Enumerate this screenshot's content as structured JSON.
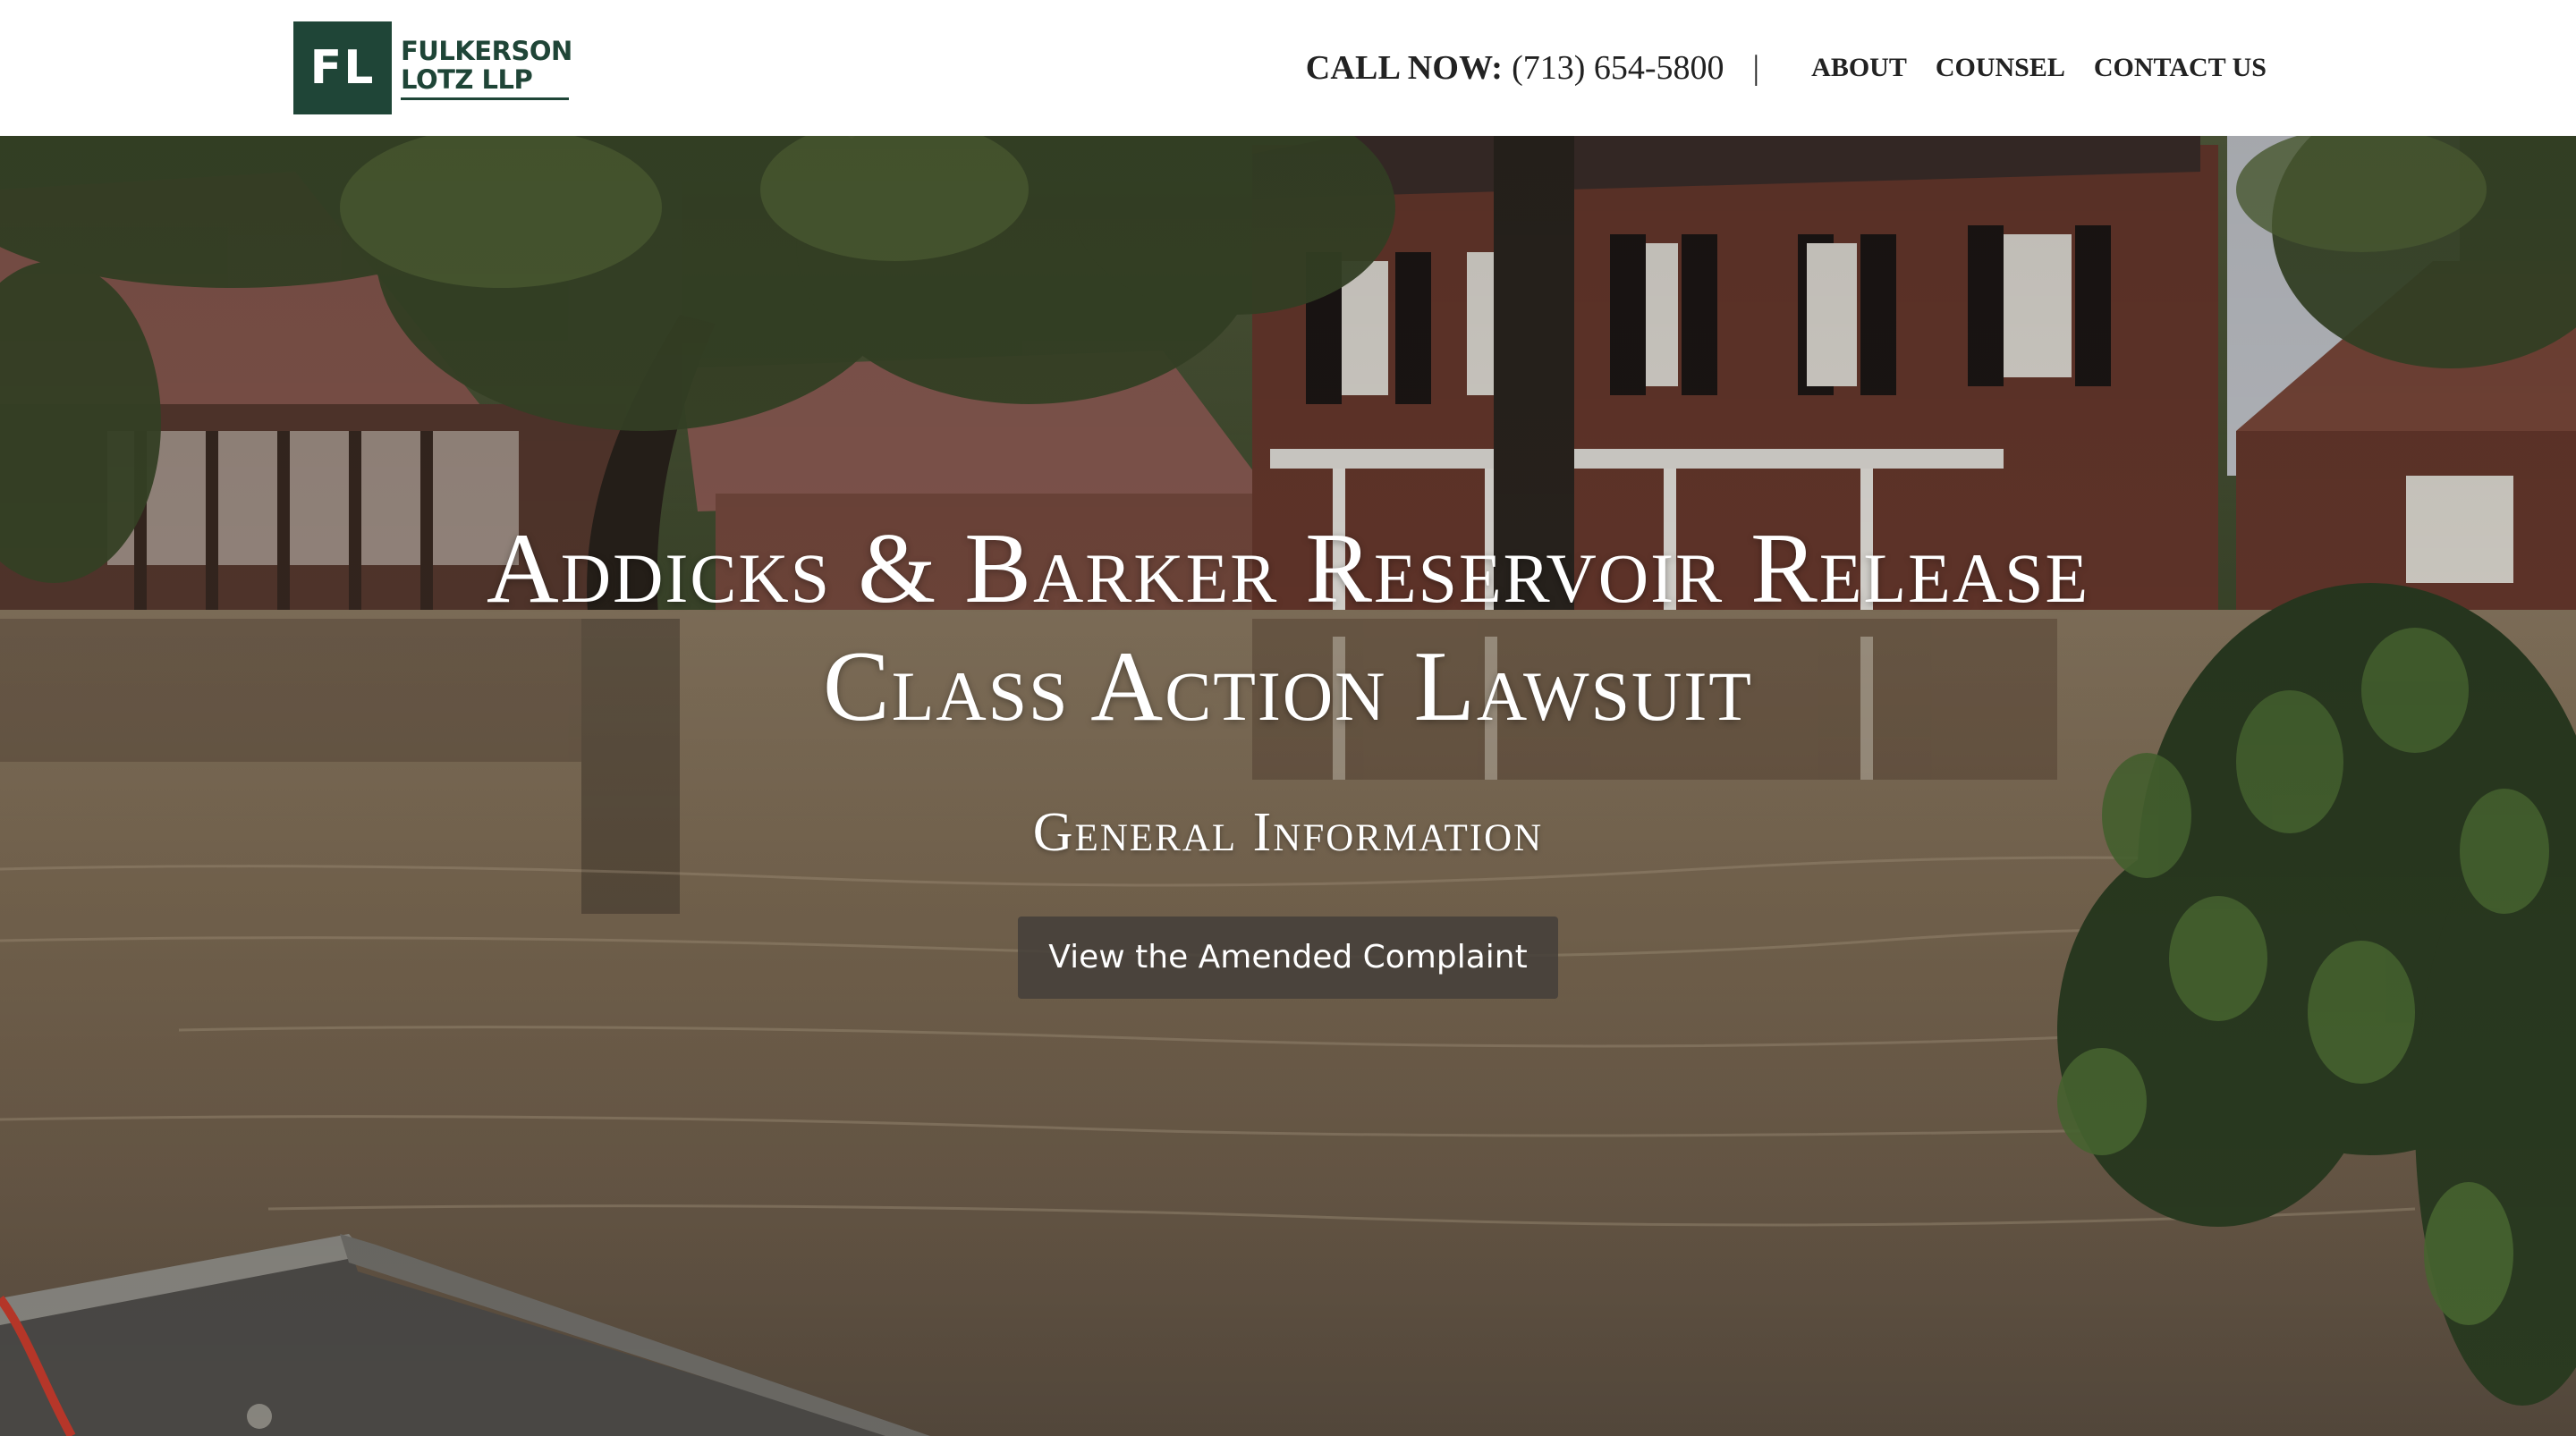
{
  "header": {
    "logo_mark": "FL",
    "logo_line1": "FULKERSON",
    "logo_line2": "LOTZ LLP",
    "call_label": "CALL NOW:",
    "call_number": "(713) 654-5800",
    "separator": "|",
    "nav": [
      {
        "label": "ABOUT"
      },
      {
        "label": "COUNSEL"
      },
      {
        "label": "CONTACT US"
      }
    ]
  },
  "hero": {
    "title_line1": "Addicks & Barker Reservoir Release",
    "title_line2": "Class Action Lawsuit",
    "subtitle": "General Information",
    "button_label": "View the Amended Complaint"
  },
  "colors": {
    "brand": "#1f4537",
    "button_bg": "#46403a",
    "header_bg": "#ffffff",
    "text_dark": "#222222"
  }
}
